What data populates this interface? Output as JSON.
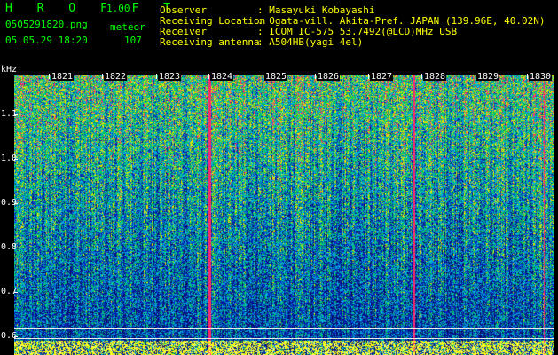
{
  "header": {
    "app_name": "H R O F F T",
    "version": "1.00",
    "filename": "0505291820.png",
    "category": "meteor",
    "datetime": "05.05.29 18:20",
    "count": "107"
  },
  "station": {
    "observer_label": "Observer",
    "observer_value": ": Masayuki Kobayashi",
    "location_label": "Receiving Location",
    "location_value": ": Ogata-vill. Akita-Pref. JAPAN (139.96E, 40.02N)",
    "receiver_label": "Receiver",
    "receiver_value": ": ICOM IC-575 53.7492(@LCD)MHz USB",
    "antenna_label": "Receiving antenna",
    "antenna_value": ": A504HB(yagi 4el)"
  },
  "axis": {
    "unit": "kHz",
    "freq_labels": [
      "1.1",
      "1.0",
      "0.9",
      "0.8",
      "0.7",
      "0.6"
    ],
    "time_labels": [
      "1821",
      "1822",
      "1823",
      "1824",
      "1825",
      "1826",
      "1827",
      "1828",
      "1829",
      "1830"
    ]
  },
  "colors": {
    "label_green": "#00ff00",
    "value_yellow": "#ffff00",
    "background": "#000000",
    "spectrum_low": "#0a1a8c",
    "spectrum_mid": "#00b4e6",
    "spectrum_high": "#ffff00",
    "meteor_echo": "#ff2a6a"
  }
}
